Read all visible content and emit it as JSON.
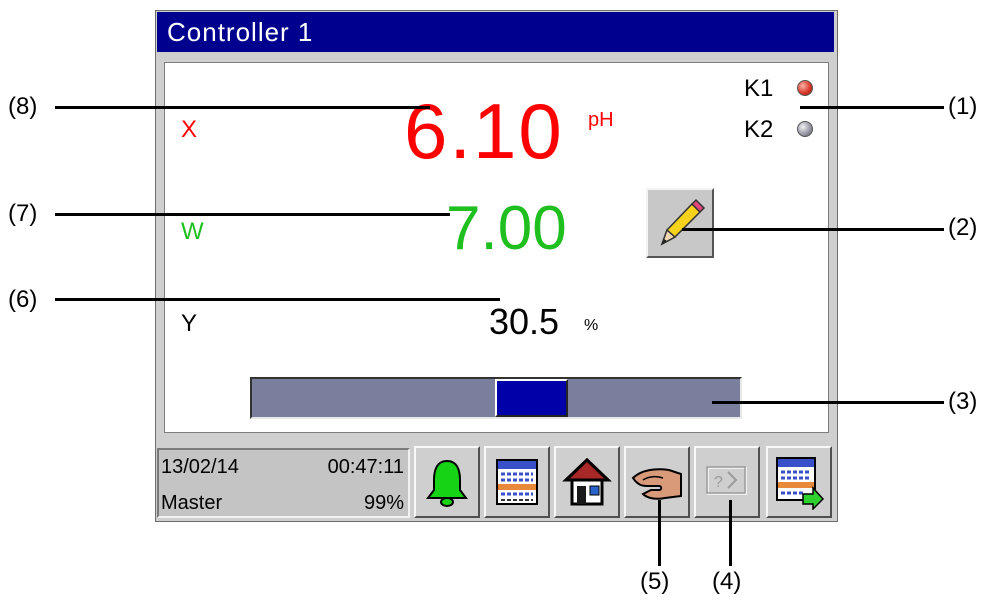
{
  "window": {
    "title": "Controller 1"
  },
  "indicators": [
    {
      "label": "K1",
      "state": "active",
      "color": "#d93a2a"
    },
    {
      "label": "K2",
      "state": "inactive",
      "color": "#9a9aa8"
    }
  ],
  "process_value": {
    "label": "X",
    "value": "6.10",
    "unit": "pH",
    "color": "#ff0000"
  },
  "setpoint": {
    "label": "W",
    "value": "7.00",
    "color": "#1ebf1e"
  },
  "output": {
    "label": "Y",
    "value": "30.5",
    "unit": "%",
    "level_percent": 30.5
  },
  "status": {
    "date": "13/02/14",
    "time": "00:47:11",
    "user": "Master",
    "memory": "99%"
  },
  "toolbar": [
    {
      "name": "alarm",
      "icon": "bell-icon"
    },
    {
      "name": "list",
      "icon": "list-icon"
    },
    {
      "name": "home",
      "icon": "home-icon"
    },
    {
      "name": "manual",
      "icon": "hand-icon"
    },
    {
      "name": "help",
      "icon": "help-icon",
      "enabled": false
    },
    {
      "name": "list-export",
      "icon": "list-arrow-icon"
    }
  ],
  "callouts": [
    "(1)",
    "(2)",
    "(3)",
    "(4)",
    "(5)",
    "(6)",
    "(7)",
    "(8)"
  ]
}
